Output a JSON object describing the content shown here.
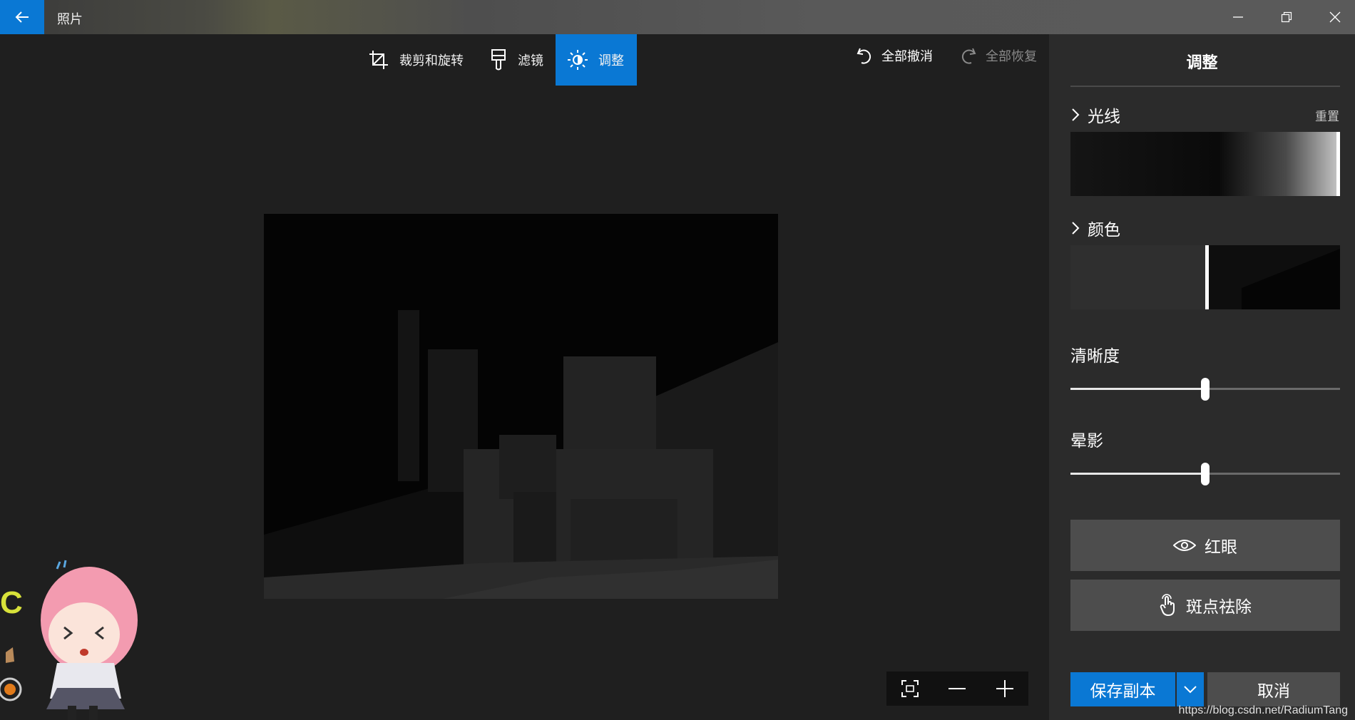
{
  "titlebar": {
    "app_title": "照片",
    "back_icon": "back-arrow-icon",
    "minimize_icon": "minimize-icon",
    "restore_icon": "restore-icon",
    "close_icon": "close-icon"
  },
  "toolbar": {
    "tools": [
      {
        "label": "裁剪和旋转",
        "icon": "crop-rotate-icon"
      },
      {
        "label": "滤镜",
        "icon": "filter-brush-icon"
      },
      {
        "label": "调整",
        "icon": "brightness-icon",
        "active": true
      }
    ],
    "undo_all": "全部撤消",
    "redo_all": "全部恢复"
  },
  "zoom": {
    "fit_icon": "fit-to-screen-icon",
    "zoom_out_icon": "zoom-out-icon",
    "zoom_in_icon": "zoom-in-icon"
  },
  "panel": {
    "title": "调整",
    "light": {
      "label": "光线",
      "reset": "重置",
      "level": 0.99
    },
    "color": {
      "label": "颜色",
      "level": 0.5
    },
    "clarity": {
      "label": "清晰度",
      "value": 0.5
    },
    "vignette": {
      "label": "晕影",
      "value": 0.5
    },
    "red_eye": "红眼",
    "spot_fix": "斑点祛除",
    "save_copy": "保存副本",
    "cancel": "取消"
  },
  "watermark": "https://blog.csdn.net/RadiumTang",
  "colors": {
    "accent": "#0a78d4",
    "panel": "#2b2b2b",
    "canvas": "#1f1f1f"
  }
}
